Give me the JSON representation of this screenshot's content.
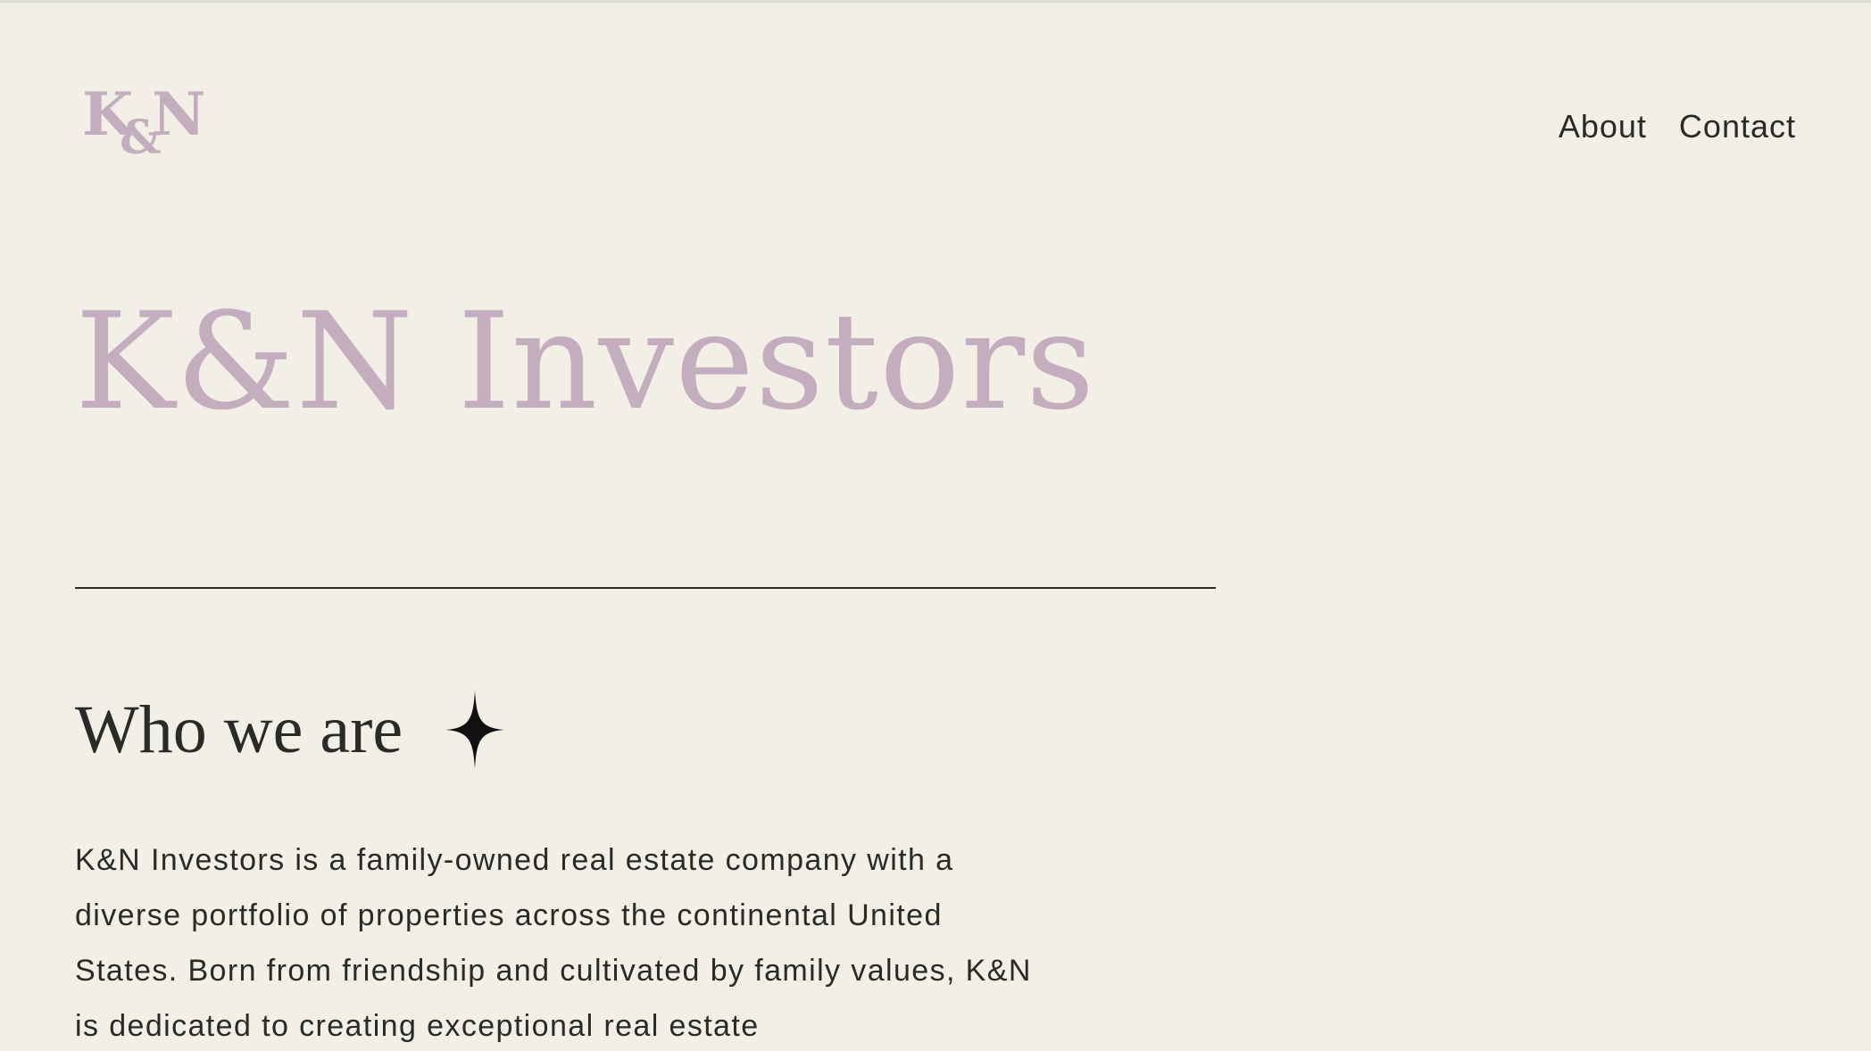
{
  "header": {
    "logo": {
      "k": "K",
      "amp": "&",
      "n": "N"
    },
    "nav": [
      {
        "label": "About"
      },
      {
        "label": "Contact"
      }
    ]
  },
  "hero": {
    "title": "K&N Investors"
  },
  "about": {
    "heading": "Who we are",
    "icon": "sparkle-icon",
    "body": "K&N Investors is a family-owned real estate company with a diverse portfolio of properties across the continental United States. Born from friendship and cultivated by family values, K&N is dedicated to creating exceptional real estate"
  },
  "colors": {
    "background": "#f2f0e6",
    "accent": "#c3adbf",
    "text": "#2a2a28"
  }
}
